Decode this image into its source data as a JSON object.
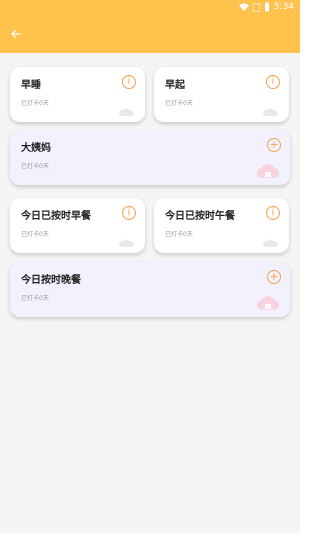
{
  "status": {
    "time": "5:34"
  },
  "cards": [
    {
      "title": "早睡",
      "meta": "已打卡0天",
      "action": "i"
    },
    {
      "title": "早起",
      "meta": "已打卡0天",
      "action": "i"
    },
    {
      "title": "大姨妈",
      "meta": "已打卡0天",
      "action": "+"
    },
    {
      "title": "今日已按时早餐",
      "meta": "已打卡0天",
      "action": "i"
    },
    {
      "title": "今日已按时午餐",
      "meta": "已打卡0天",
      "action": "i"
    },
    {
      "title": "今日按时晚餐",
      "meta": "已打卡0天",
      "action": "+"
    }
  ],
  "colors": {
    "accent": "#FFC24D",
    "button": "#F5A24B",
    "wide_card": "#F2F1FD"
  }
}
